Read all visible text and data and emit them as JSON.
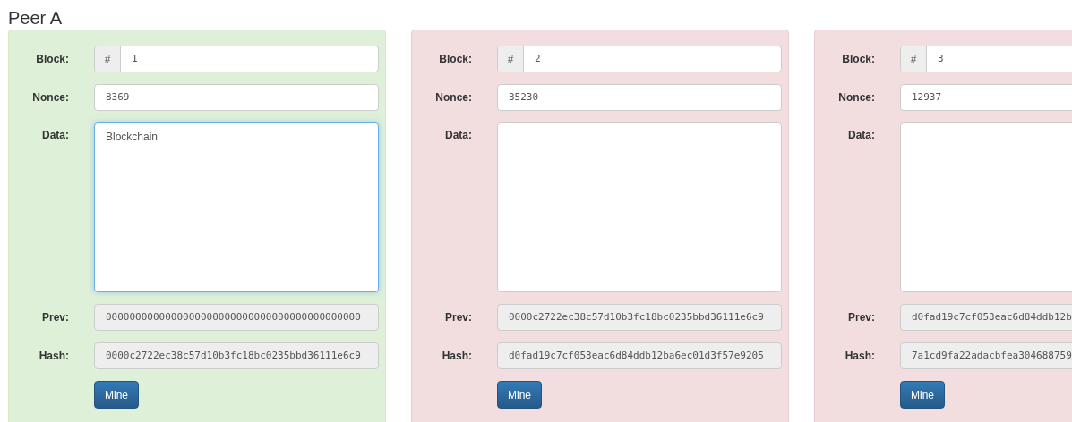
{
  "title": "Peer A",
  "blocks": [
    {
      "valid": true,
      "block_label": "Block:",
      "block_prefix": "#",
      "block": "1",
      "nonce_label": "Nonce:",
      "nonce": "8369",
      "data_label": "Data:",
      "data": "Blockchain",
      "focused": true,
      "prev_label": "Prev:",
      "prev": "0000000000000000000000000000000000000000000",
      "hash_label": "Hash:",
      "hash": "0000c2722ec38c57d10b3fc18bc0235bbd36111e6c9",
      "button": "Mine"
    },
    {
      "valid": false,
      "block_label": "Block:",
      "block_prefix": "#",
      "block": "2",
      "nonce_label": "Nonce:",
      "nonce": "35230",
      "data_label": "Data:",
      "focused": false,
      "prev_label": "Prev:",
      "prev": "0000c2722ec38c57d10b3fc18bc0235bbd36111e6c9",
      "hash_label": "Hash:",
      "hash": "d0fad19c7cf053eac6d84ddb12ba6ec01d3f57e9205",
      "button": "Mine"
    },
    {
      "valid": false,
      "block_label": "Block:",
      "block_prefix": "#",
      "block": "3",
      "nonce_label": "Nonce:",
      "nonce": "12937",
      "data_label": "Data:",
      "focused": false,
      "prev_label": "Prev:",
      "prev": "d0fad19c7cf053eac6d84ddb12b",
      "hash_label": "Hash:",
      "hash": "7a1cd9fa22adacbfea304688759",
      "button": "Mine"
    }
  ]
}
